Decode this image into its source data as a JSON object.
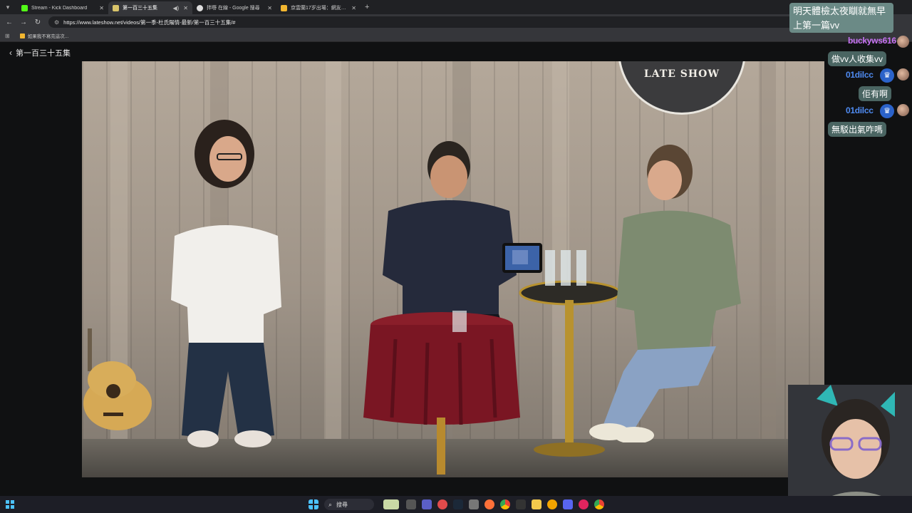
{
  "browser": {
    "tabs": [
      {
        "title": "Stream - Kick Dashboard",
        "favicon_color": "#53fc18",
        "active": false
      },
      {
        "title": "第一百三十五集",
        "favicon_color": "#d9c46a",
        "active": true
      },
      {
        "title": "拌嘢 在線 - Google 搜尋",
        "favicon_color": "#dddddd",
        "active": false
      },
      {
        "title": "京雲蘭17岁出場：網友怒轟吳...",
        "favicon_color": "#f2b630",
        "active": false
      }
    ],
    "new_tab_symbol": "+",
    "url": "https://www.lateshow.net/videos/第一季-杜氏陽情-最新/第一百三十五集/#",
    "bookmark_label": "如果我不寫完這次..."
  },
  "page": {
    "title": "第一百三十五集",
    "video": {
      "logo_text": "LATE SHOW"
    }
  },
  "chat": {
    "messages": [
      {
        "text": "明天體檢太夜瞓就無早上第一篇vv",
        "user": "buckyws616",
        "user_color": "#c873f5"
      },
      {
        "text": "做vv人收集vv",
        "user": "01dilcc",
        "user_color": "#4f8bf1"
      },
      {
        "text": "佢有啊",
        "user": "01dilcc",
        "user_color": "#4f8bf1"
      },
      {
        "text": "無駁出氣咋嗎",
        "user": "",
        "user_color": ""
      }
    ]
  },
  "taskbar": {
    "search_label": "搜尋"
  },
  "colors": {
    "chrome_dark": "#202124",
    "chrome_bar": "#35363a",
    "chat_bubble": "#4a6562",
    "accent_blue": "#2b62c9"
  }
}
